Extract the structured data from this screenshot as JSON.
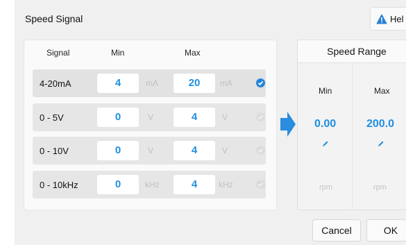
{
  "dialog": {
    "title": "Speed Signal",
    "help_label": "Hel"
  },
  "signal_table": {
    "headers": {
      "signal": "Signal",
      "min": "Min",
      "max": "Max"
    },
    "rows": [
      {
        "label": "4-20mA",
        "min": "4",
        "max": "20",
        "unit": "mA",
        "selected": true
      },
      {
        "label": "0 - 5V",
        "min": "0",
        "max": "4",
        "unit": "V",
        "selected": false
      },
      {
        "label": "0 - 10V",
        "min": "0",
        "max": "4",
        "unit": "V",
        "selected": false
      },
      {
        "label": "0 - 10kHz",
        "min": "0",
        "max": "4",
        "unit": "kHz",
        "selected": false
      }
    ]
  },
  "speed_range": {
    "title": "Speed Range",
    "min_header": "Min",
    "max_header": "Max",
    "min_value": "0.00",
    "max_value": "200.0",
    "min_unit": "rpm",
    "max_unit": "rpm"
  },
  "footer": {
    "cancel_label": "Cancel",
    "ok_label": "OK"
  },
  "colors": {
    "accent": "#1f8fe0",
    "check_selected": "#2384dc",
    "warning": "#2a7fd4"
  },
  "icons": {
    "help": "warning-triangle-icon",
    "selected": "checkmark-circle-icon",
    "unselected": "circle-icon",
    "arrow": "arrow-right-icon",
    "edit": "pencil-icon"
  }
}
